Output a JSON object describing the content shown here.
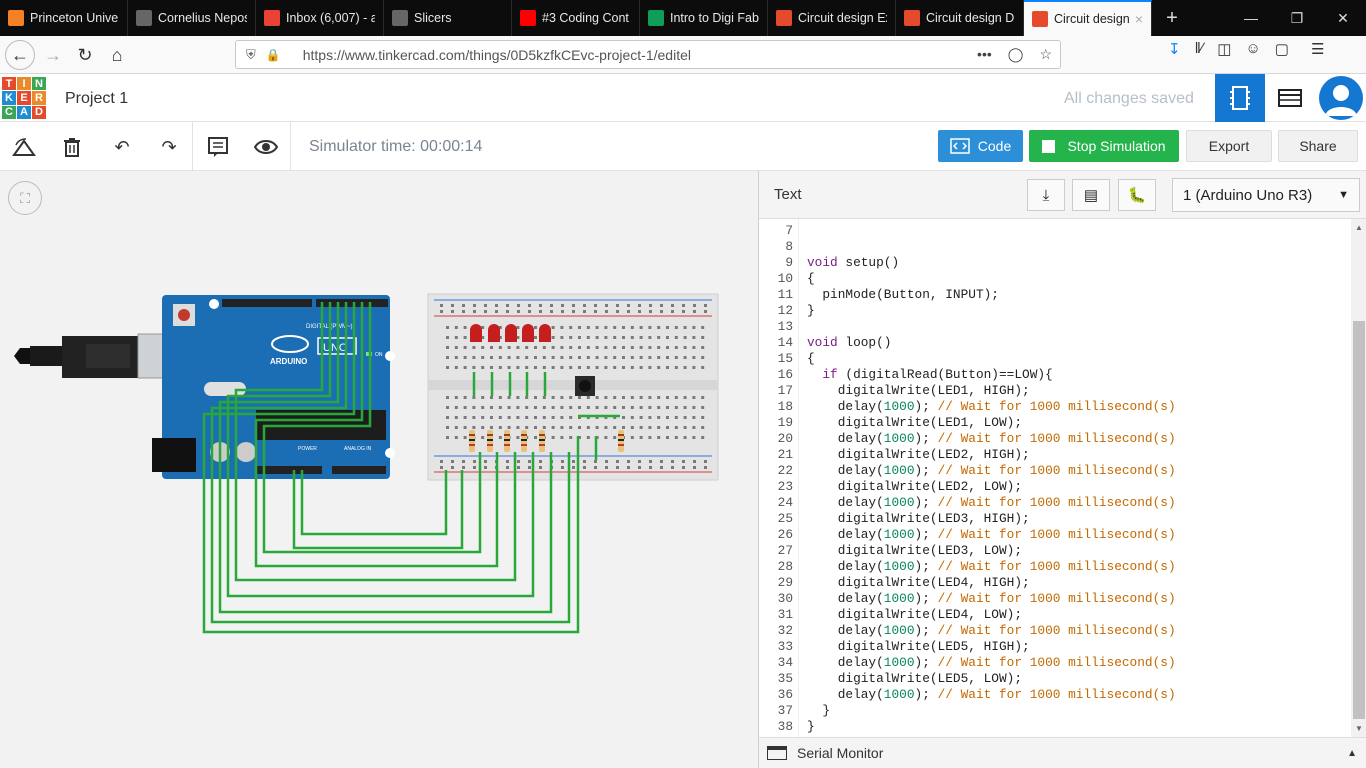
{
  "browser": {
    "tabs": [
      {
        "title": "Princeton Univer",
        "icon": "princeton-icon",
        "color": "#f58025"
      },
      {
        "title": "Cornelius Nepos: Liv",
        "icon": "page-icon",
        "color": "#666666"
      },
      {
        "title": "Inbox (6,007) - a",
        "icon": "gmail-icon",
        "color": "#ea4335"
      },
      {
        "title": "Slicers",
        "icon": "page-icon",
        "color": "#666666"
      },
      {
        "title": "#3 Coding Cont",
        "icon": "youtube-icon",
        "color": "#ff0000"
      },
      {
        "title": "Intro to Digi Fab",
        "icon": "sheets-icon",
        "color": "#0f9d58"
      },
      {
        "title": "Circuit design Ex",
        "icon": "tinkercad-icon",
        "color": "#e44b2a"
      },
      {
        "title": "Circuit design D",
        "icon": "tinkercad-icon",
        "color": "#e44b2a"
      },
      {
        "title": "Circuit design",
        "icon": "tinkercad-icon",
        "color": "#e44b2a",
        "active": true
      }
    ],
    "url": "https://www.tinkercad.com/things/0D5kzfkCEvc-project-1/editel"
  },
  "app": {
    "logo_letters": [
      "T",
      "I",
      "N",
      "K",
      "E",
      "R",
      "C",
      "A",
      "D"
    ],
    "project_name": "Project 1",
    "save_status": "All changes saved",
    "simulator_time": "Simulator time: 00:00:14",
    "code_button": "Code",
    "stop_button": "Stop Simulation",
    "export_button": "Export",
    "share_button": "Share",
    "colors": {
      "accent": "#1477d1",
      "code": "#2c8fd8",
      "stop": "#25b34b"
    }
  },
  "circuit": {
    "board_label": "ARDUINO",
    "board_model": "UNO",
    "digital_label": "DIGITAL (PWM~)",
    "power_label": "POWER",
    "analog_label": "ANALOG IN",
    "on_label": "ON",
    "led_count": 5
  },
  "panel": {
    "title": "Text",
    "device": "1 (Arduino Uno R3)",
    "serial_monitor": "Serial Monitor",
    "code_lines": [
      {
        "n": "7",
        "t": ""
      },
      {
        "n": "8",
        "t": ""
      },
      {
        "n": "9",
        "t": "void setup()"
      },
      {
        "n": "10",
        "t": "{"
      },
      {
        "n": "11",
        "t": "  pinMode(Button, INPUT);"
      },
      {
        "n": "12",
        "t": "}"
      },
      {
        "n": "13",
        "t": ""
      },
      {
        "n": "14",
        "t": "void loop()"
      },
      {
        "n": "15",
        "t": "{"
      },
      {
        "n": "16",
        "t": "  if (digitalRead(Button)==LOW){"
      },
      {
        "n": "17",
        "t": "    digitalWrite(LED1, HIGH);"
      },
      {
        "n": "18",
        "t": "    delay(1000); // Wait for 1000 millisecond(s)"
      },
      {
        "n": "19",
        "t": "    digitalWrite(LED1, LOW);"
      },
      {
        "n": "20",
        "t": "    delay(1000); // Wait for 1000 millisecond(s)"
      },
      {
        "n": "21",
        "t": "    digitalWrite(LED2, HIGH);"
      },
      {
        "n": "22",
        "t": "    delay(1000); // Wait for 1000 millisecond(s)"
      },
      {
        "n": "23",
        "t": "    digitalWrite(LED2, LOW);"
      },
      {
        "n": "24",
        "t": "    delay(1000); // Wait for 1000 millisecond(s)"
      },
      {
        "n": "25",
        "t": "    digitalWrite(LED3, HIGH);"
      },
      {
        "n": "26",
        "t": "    delay(1000); // Wait for 1000 millisecond(s)"
      },
      {
        "n": "27",
        "t": "    digitalWrite(LED3, LOW);"
      },
      {
        "n": "28",
        "t": "    delay(1000); // Wait for 1000 millisecond(s)"
      },
      {
        "n": "29",
        "t": "    digitalWrite(LED4, HIGH);"
      },
      {
        "n": "30",
        "t": "    delay(1000); // Wait for 1000 millisecond(s)"
      },
      {
        "n": "31",
        "t": "    digitalWrite(LED4, LOW);"
      },
      {
        "n": "32",
        "t": "    delay(1000); // Wait for 1000 millisecond(s)"
      },
      {
        "n": "33",
        "t": "    digitalWrite(LED5, HIGH);"
      },
      {
        "n": "34",
        "t": "    delay(1000); // Wait for 1000 millisecond(s)"
      },
      {
        "n": "35",
        "t": "    digitalWrite(LED5, LOW);"
      },
      {
        "n": "36",
        "t": "    delay(1000); // Wait for 1000 millisecond(s)"
      },
      {
        "n": "37",
        "t": "  }"
      },
      {
        "n": "38",
        "t": "}"
      }
    ]
  }
}
